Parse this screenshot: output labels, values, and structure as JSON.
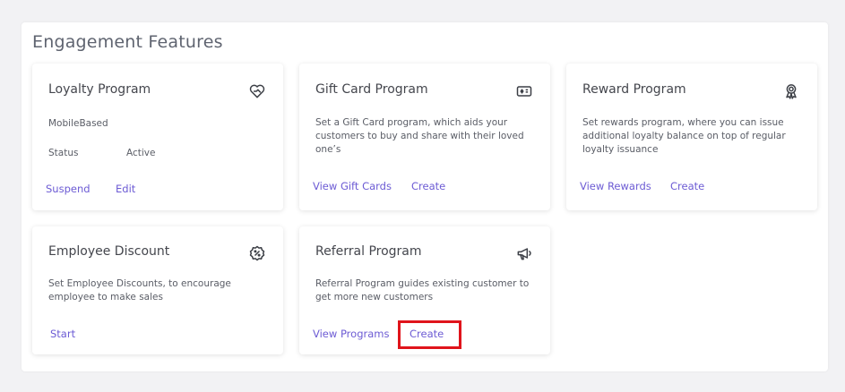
{
  "section": {
    "title": "Engagement Features"
  },
  "loyalty": {
    "title": "Loyalty Program",
    "icon": "heart-hand-icon",
    "type": "MobileBased",
    "status_label": "Status",
    "status_value": "Active",
    "suspend_label": "Suspend",
    "edit_label": "Edit"
  },
  "gift_card": {
    "title": "Gift Card Program",
    "icon": "gift-card-icon",
    "description": "Set a Gift Card program, which aids your customers to buy and share with their loved one’s",
    "view_label": "View Gift Cards",
    "create_label": "Create"
  },
  "reward": {
    "title": "Reward Program",
    "icon": "award-badge-icon",
    "description": "Set rewards program, where you can issue additional loyalty balance on top of regular loyalty issuance",
    "view_label": "View Rewards",
    "create_label": "Create"
  },
  "employee": {
    "title": "Employee Discount",
    "icon": "discount-badge-icon",
    "description": "Set Employee Discounts, to encourage employee to make sales",
    "start_label": "Start"
  },
  "referral": {
    "title": "Referral Program",
    "icon": "megaphone-icon",
    "description": "Referral Program guides existing customer to get more new customers",
    "view_label": "View Programs",
    "create_label": "Create"
  },
  "colors": {
    "link": "#6c5bd4",
    "highlight": "#e0141b",
    "text": "#44464d"
  }
}
